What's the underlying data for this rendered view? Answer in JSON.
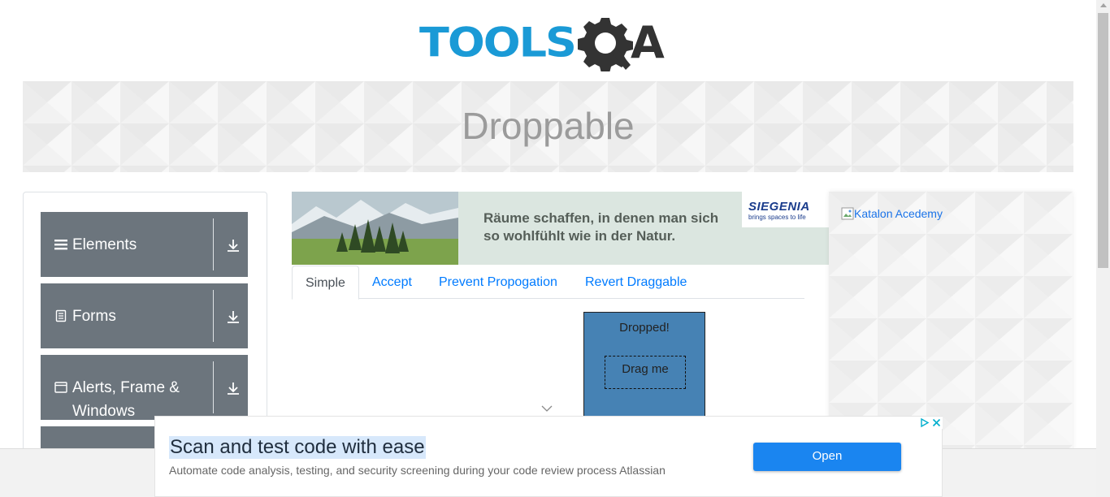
{
  "header": {
    "logo_text": "TOOLS",
    "logo_suffix": "A"
  },
  "banner": {
    "title": "Droppable"
  },
  "sidebar": {
    "groups": [
      {
        "label": "Elements",
        "icon": "hamburger-icon"
      },
      {
        "label": "Forms",
        "icon": "document-icon"
      },
      {
        "label": "Alerts, Frame & Windows",
        "icon": "window-icon"
      }
    ]
  },
  "top_ad": {
    "text_line1": "Räume schaffen, in denen man sich",
    "text_line2": "so wohlfühlt wie in der Natur.",
    "brand": "SIEGENIA",
    "brand_tagline": "brings spaces to life"
  },
  "tabs": [
    {
      "label": "Simple",
      "active": true
    },
    {
      "label": "Accept",
      "active": false
    },
    {
      "label": "Prevent Propogation",
      "active": false
    },
    {
      "label": "Revert Draggable",
      "active": false
    }
  ],
  "droppable": {
    "drop_label": "Dropped!",
    "drag_label": "Drag me",
    "drop_color": "#4682b4"
  },
  "right_ad": {
    "alt_text": "Katalon Acedemy"
  },
  "bottom_ad": {
    "headline": "Scan and test code with ease",
    "description": "Automate code analysis, testing, and security screening during your code review process Atlassian",
    "button_label": "Open",
    "button_color": "#1a85f0"
  },
  "colors": {
    "brand_blue": "#1a9ad6",
    "sidebar_gray": "#6c757d",
    "link_blue": "#007bff"
  }
}
